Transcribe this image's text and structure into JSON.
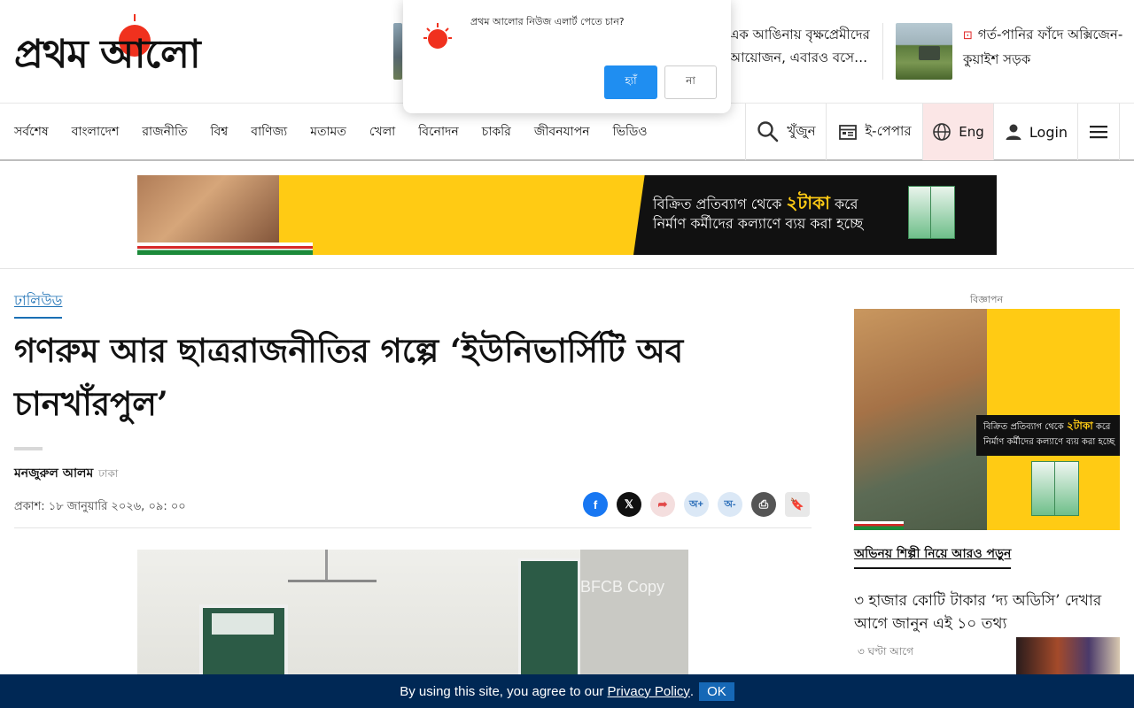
{
  "site": {
    "logo_text": "প্রথম আলো",
    "brand_red": "#f0311e"
  },
  "header_teasers": [
    {
      "title": "এক আঙিনায় বৃক্ষপ্রেমীদের আয়োজন, এবারও বসে…"
    },
    {
      "live_icon": "live-icon",
      "title": "গর্ত-পানির ফাঁদে অক্সিজেন-কুয়াইশ সড়ক"
    }
  ],
  "notification": {
    "text": "প্রথম আলোর নিউজ এলার্ট পেতে চান?",
    "yes_label": "হ্যাঁ",
    "no_label": "না"
  },
  "nav": {
    "links": [
      "সর্বশেষ",
      "বাংলাদেশ",
      "রাজনীতি",
      "বিশ্ব",
      "বাণিজ্য",
      "মতামত",
      "খেলা",
      "বিনোদন",
      "চাকরি",
      "জীবনযাপন",
      "ভিডিও"
    ],
    "search_label": "খুঁজুন",
    "epaper_label": "ই-পেপার",
    "lang_label": "Eng",
    "login_label": "Login"
  },
  "top_ad": {
    "line1_pre": "বিক্রিত প্রতিব্যাগ থেকে",
    "line1_hl": "২টাকা",
    "line1_post": "করে",
    "line2": "নির্মাণ কর্মীদের কল্যাণে ব্যয় করা হচ্ছে"
  },
  "article": {
    "category": "ঢালিউড",
    "headline": "গণরুম আর ছাত্ররাজনীতির গল্পে ‘ইউনিভার্সিটি অব চানখাঁরপুল’",
    "author": "মনজুরুল আলম",
    "location": "ঢাকা",
    "published": "প্রকাশ: ১৮ জানুয়ারি ২০২৬, ০৯: ০০",
    "share": {
      "facebook": "f",
      "x": "𝕏",
      "share": "➦",
      "font_plus": "অ+",
      "font_minus": "অ-",
      "print": "⎙",
      "bookmark": "🔖"
    },
    "photo_watermark": "BFCB Copy"
  },
  "sidebar": {
    "ad_label": "বিজ্ঞাপন",
    "ad_line1_pre": "বিক্রিত প্রতিব্যাগ থেকে",
    "ad_line1_hl": "২টাকা",
    "ad_line1_post": "করে",
    "ad_line2": "নির্মাণ কর্মীদের কল্যাণে ব্যয় করা হচ্ছে",
    "more_label": "অভিনয় শিল্পী নিয়ে আরও পড়ুন",
    "story_title": "৩ হাজার কোটি টাকার ‘দ্য অডিসি’ দেখার আগে জানুন এই ১০ তথ্য",
    "story_time": "৩ ঘণ্টা আগে"
  },
  "cookie": {
    "text_pre": "By using this site, you agree to our",
    "link": "Privacy Policy",
    "text_post": ".",
    "ok_label": "OK"
  }
}
